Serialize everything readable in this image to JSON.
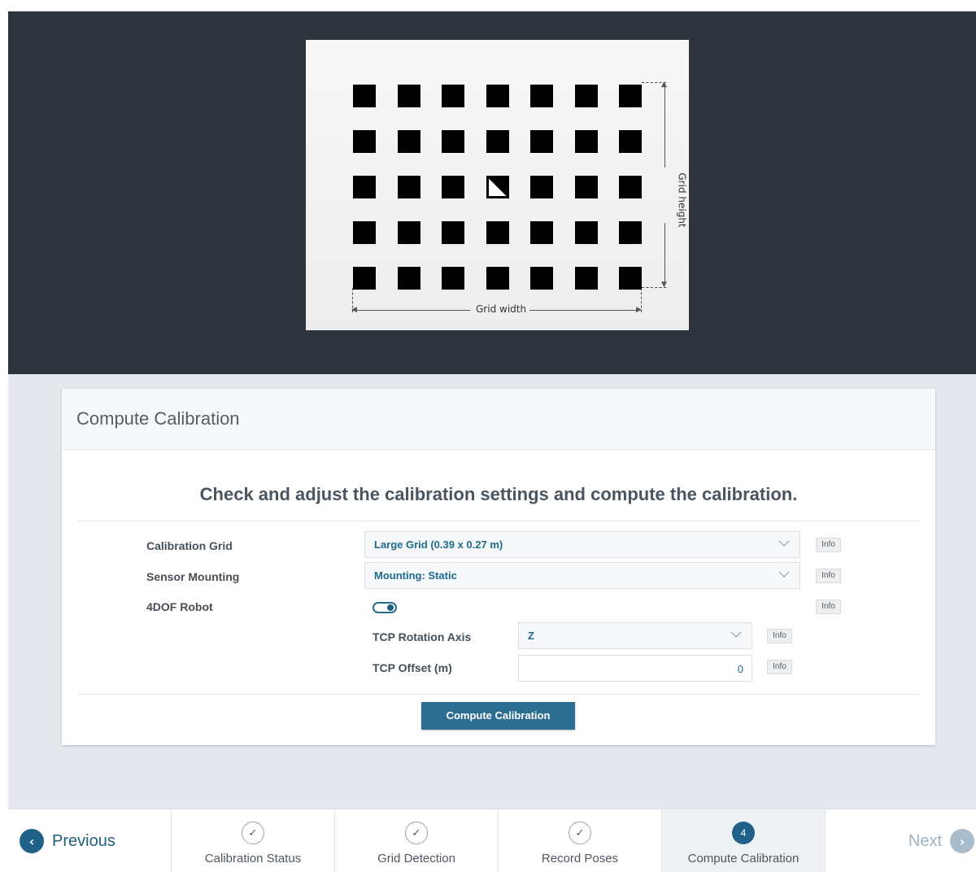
{
  "visual": {
    "grid_width_label": "Grid width",
    "grid_height_label": "Grid height"
  },
  "card": {
    "title": "Compute Calibration",
    "headline": "Check and adjust the calibration settings and compute the calibration.",
    "rows": {
      "calibration_grid": {
        "label": "Calibration Grid",
        "value": "Large Grid (0.39 x 0.27 m)",
        "info": "Info"
      },
      "sensor_mounting": {
        "label": "Sensor Mounting",
        "value": "Mounting: Static",
        "info": "Info"
      },
      "robot_4dof": {
        "label": "4DOF Robot",
        "toggle_on": true,
        "info": "Info"
      },
      "tcp_rotation_axis": {
        "label": "TCP Rotation Axis",
        "value": "Z",
        "info": "Info"
      },
      "tcp_offset": {
        "label": "TCP Offset (m)",
        "value": "0",
        "info": "Info"
      }
    },
    "compute_button": "Compute Calibration"
  },
  "nav": {
    "previous": "Previous",
    "next": "Next",
    "steps": [
      {
        "label": "Calibration Status",
        "state": "done",
        "icon": "check-icon"
      },
      {
        "label": "Grid Detection",
        "state": "done",
        "icon": "check-icon"
      },
      {
        "label": "Record Poses",
        "state": "done",
        "icon": "check-icon"
      },
      {
        "label": "Compute Calibration",
        "state": "active",
        "number": "4"
      }
    ]
  },
  "colors": {
    "dark_bg": "#2e343c",
    "accent": "#1f6188",
    "page_bg": "#e4e8ec"
  }
}
